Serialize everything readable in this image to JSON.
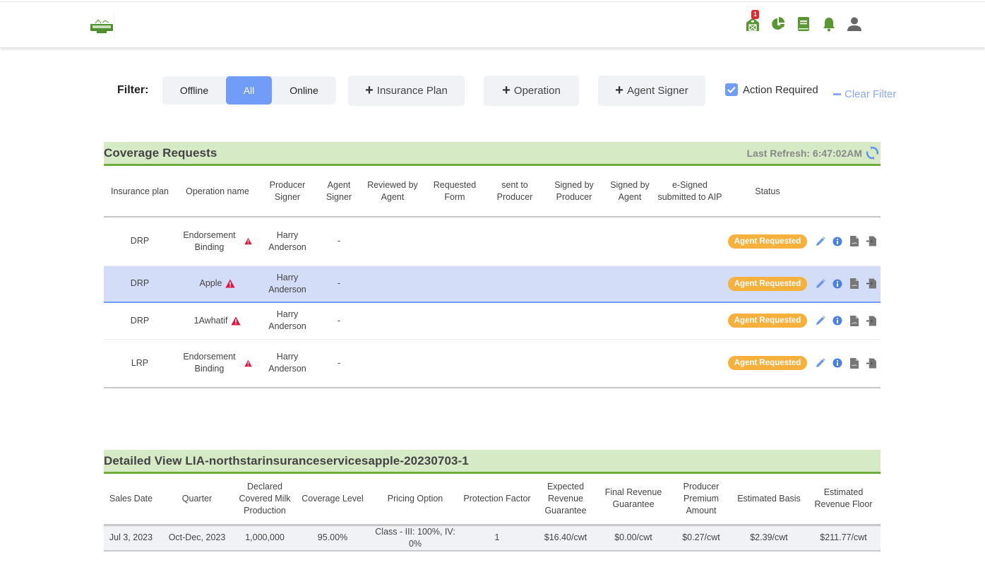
{
  "header": {
    "logo_alt": "logo",
    "nav": [
      {
        "icon": "barn-icon",
        "badge": "1"
      },
      {
        "icon": "pie-chart-icon"
      },
      {
        "icon": "book-icon"
      },
      {
        "icon": "bell-icon"
      },
      {
        "icon": "user-icon"
      }
    ]
  },
  "filter": {
    "label": "Filter:",
    "segments": [
      {
        "label": "Offline",
        "active": false
      },
      {
        "label": "All",
        "active": true
      },
      {
        "label": "Online",
        "active": false
      }
    ],
    "add_buttons": {
      "insurance_plan": "Insurance Plan",
      "operation": "Operation",
      "agent_signer": "Agent Signer"
    },
    "action_required": {
      "label": "Action Required",
      "checked": true
    },
    "clear_filter": "Clear Filter"
  },
  "coverage": {
    "title": "Coverage Requests",
    "last_refresh": "Last Refresh: 6:47:02AM",
    "columns": [
      "Insurance plan",
      "Operation name",
      "Producer Signer",
      "Agent Signer",
      "Reviewed by Agent",
      "Requested Form",
      "sent to Producer",
      "Signed by Producer",
      "Signed by Agent",
      "e-Signed submitted to AIP",
      "Status"
    ],
    "rows": [
      {
        "plan": "DRP",
        "operation": "Endorsement Binding",
        "producer_signer": "Harry Anderson",
        "agent_signer": "-",
        "reviewed": "",
        "requested_form": "",
        "sent": "",
        "signed_producer": "",
        "signed_agent": "",
        "esigned": "",
        "status": "Agent Requested"
      },
      {
        "plan": "DRP",
        "operation": "Apple",
        "producer_signer": "Harry Anderson",
        "agent_signer": "-",
        "reviewed": "",
        "requested_form": "",
        "sent": "",
        "signed_producer": "",
        "signed_agent": "",
        "esigned": "",
        "status": "Agent Requested"
      },
      {
        "plan": "DRP",
        "operation": "1Awhatif",
        "producer_signer": "Harry Anderson",
        "agent_signer": "-",
        "reviewed": "",
        "requested_form": "",
        "sent": "",
        "signed_producer": "",
        "signed_agent": "",
        "esigned": "",
        "status": "Agent Requested"
      },
      {
        "plan": "LRP",
        "operation": "Endorsement Binding",
        "producer_signer": "Harry Anderson",
        "agent_signer": "-",
        "reviewed": "",
        "requested_form": "",
        "sent": "",
        "signed_producer": "",
        "signed_agent": "",
        "esigned": "",
        "status": "Agent Requested"
      }
    ]
  },
  "detail": {
    "title": "Detailed View LIA-northstarinsuranceservicesapple-20230703-1",
    "columns": [
      "Sales Date",
      "Quarter",
      "Declared Covered Milk Production",
      "Coverage Level",
      "Pricing Option",
      "Protection Factor",
      "Expected Revenue Guarantee",
      "Final Revenue Guarantee",
      "Producer Premium Amount",
      "Estimated Basis",
      "Estimated Revenue Floor"
    ],
    "rows": [
      [
        "Jul 3, 2023",
        "Oct-Dec, 2023",
        "1,000,000",
        "95.00%",
        "Class - III: 100%, IV: 0%",
        "1",
        "$16.40/cwt",
        "$0.00/cwt",
        "$0.27/cwt",
        "$2.39/cwt",
        "$211.77/cwt"
      ]
    ]
  },
  "colors": {
    "accent_blue": "#719df8",
    "brand_green": "#5a9632",
    "section_bg": "#d5eac5",
    "status_orange": "#f6b03c",
    "warning_red": "#e3143c"
  }
}
